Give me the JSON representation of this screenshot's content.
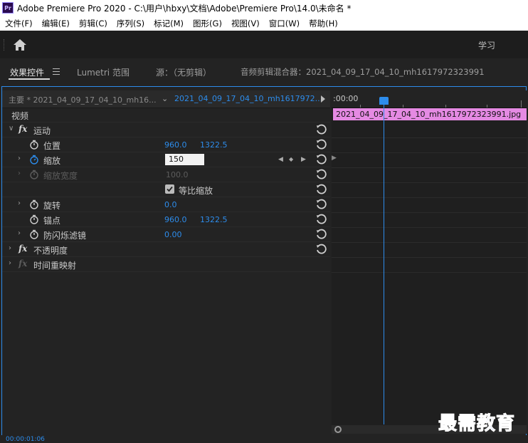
{
  "window": {
    "title": "Adobe Premiere Pro 2020 - C:\\用户\\hbxy\\文档\\Adobe\\Premiere Pro\\14.0\\未命名 *",
    "logo_text": "Pr"
  },
  "menu": [
    "文件(F)",
    "编辑(E)",
    "剪辑(C)",
    "序列(S)",
    "标记(M)",
    "图形(G)",
    "视图(V)",
    "窗口(W)",
    "帮助(H)"
  ],
  "toolbar": {
    "workspace_label": "学习"
  },
  "panel_tabs": [
    {
      "label": "效果控件",
      "active": true
    },
    {
      "label": "Lumetri 范围",
      "active": false
    },
    {
      "label": "源：（无剪辑）",
      "active": false
    },
    {
      "label": "音频剪辑混合器：2021_04_09_17_04_10_mh1617972323991",
      "active": false
    }
  ],
  "effect_controls": {
    "master_label": "主要 * 2021_04_09_17_04_10_mh16...",
    "clip_label": "2021_04_09_17_04_10_mh1617972...",
    "video_header": "视频",
    "motion": {
      "label": "运动",
      "position": {
        "label": "位置",
        "x": "960.0",
        "y": "1322.5"
      },
      "scale": {
        "label": "缩放",
        "value": "150"
      },
      "scale_width": {
        "label": "缩放宽度",
        "value": "100.0"
      },
      "uniform_scale": {
        "label": "等比缩放",
        "checked": true
      },
      "rotation": {
        "label": "旋转",
        "value": "0.0"
      },
      "anchor": {
        "label": "锚点",
        "x": "960.0",
        "y": "1322.5"
      },
      "anti_flicker": {
        "label": "防闪烁滤镜",
        "value": "0.00"
      }
    },
    "opacity": {
      "label": "不透明度"
    },
    "time_remap": {
      "label": "时间重映射"
    }
  },
  "timeline": {
    "ruler_timecode": ":00:00",
    "clip_name": "2021_04_09_17_04_10_mh1617972323991.jpg",
    "clip_color": "#e58ae3"
  },
  "status": {
    "timecode": "00:00:01:06"
  },
  "watermark": "最需教育",
  "colors": {
    "accent": "#2d8ceb"
  }
}
